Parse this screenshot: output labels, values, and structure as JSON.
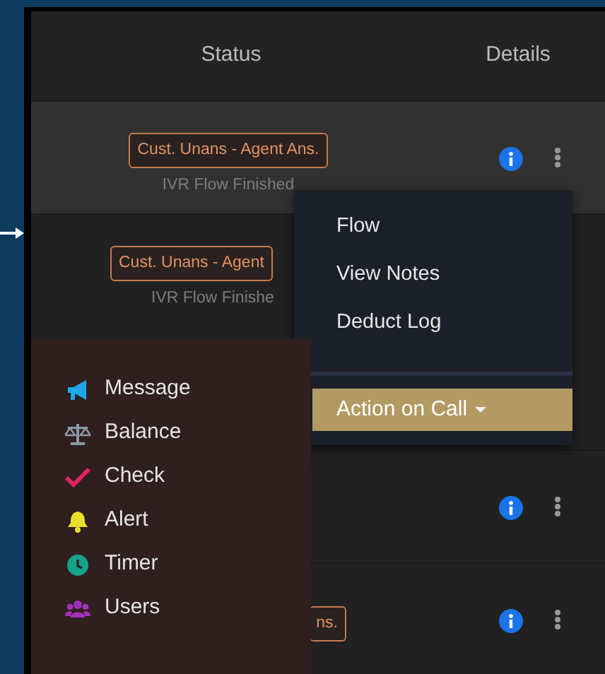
{
  "table": {
    "columns": [
      "Status",
      "Details"
    ],
    "rows": [
      {
        "badge": "Cust. Unans - Agent Ans.",
        "subtitle": "IVR Flow Finished",
        "highlighted": true,
        "details_visible": true
      },
      {
        "badge": "Cust. Unans - Agent",
        "subtitle": "IVR Flow Finishe",
        "highlighted": false
      },
      {
        "highlighted": false,
        "details_visible": true
      },
      {
        "badge": "ns.",
        "highlighted": false,
        "details_visible": true
      }
    ]
  },
  "row_menu": {
    "items": [
      "Flow",
      "View Notes",
      "Deduct Log"
    ],
    "action_button": "Action on Call"
  },
  "icon_menu": {
    "items": [
      {
        "label": "Message",
        "kind": "megaphone",
        "color": "#1ea7e8"
      },
      {
        "label": "Balance",
        "kind": "scale",
        "color": "#8a9aa6"
      },
      {
        "label": "Check",
        "kind": "check",
        "color": "#e0245e"
      },
      {
        "label": "Alert",
        "kind": "bell",
        "color": "#e6e02a"
      },
      {
        "label": "Timer",
        "kind": "clock",
        "color": "#13a58a"
      },
      {
        "label": "Users",
        "kind": "users",
        "color": "#a232b8"
      }
    ]
  }
}
